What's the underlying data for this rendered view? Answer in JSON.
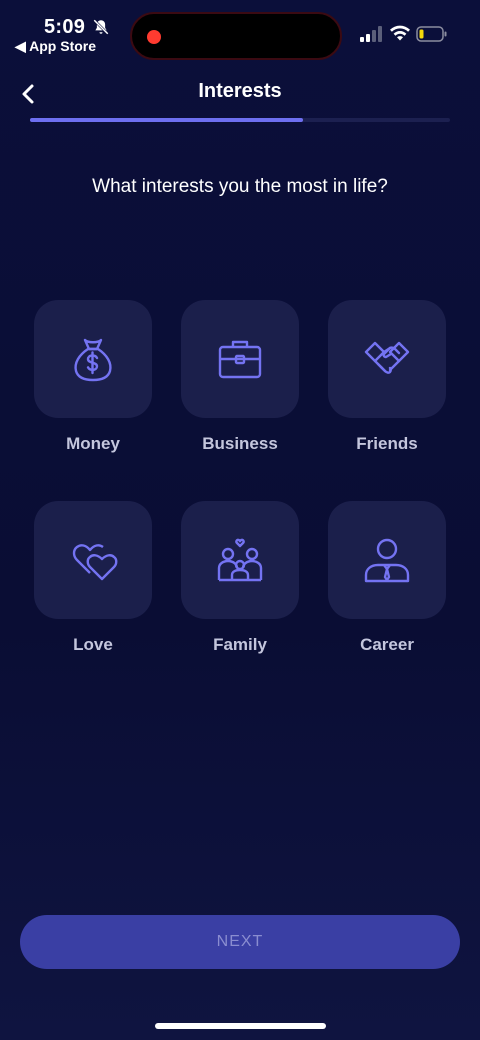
{
  "status_bar": {
    "time": "5:09",
    "back_app": "◀ App Store",
    "icons": [
      "bell-slash-icon",
      "signal-icon",
      "wifi-icon",
      "battery-low-icon"
    ],
    "recording_color": "#ff3b30"
  },
  "header": {
    "back_icon": "chevron-left-icon",
    "title": "Interests"
  },
  "progress": {
    "fraction": 0.65,
    "fill_color": "#6e6ff0"
  },
  "question": "What interests you the most in life?",
  "interests": [
    {
      "label": "Money",
      "icon": "money-bag-icon"
    },
    {
      "label": "Business",
      "icon": "briefcase-icon"
    },
    {
      "label": "Friends",
      "icon": "handshake-icon"
    },
    {
      "label": "Love",
      "icon": "hearts-icon"
    },
    {
      "label": "Family",
      "icon": "family-icon"
    },
    {
      "label": "Career",
      "icon": "person-tie-icon"
    }
  ],
  "next_button": {
    "label": "NEXT"
  },
  "colors": {
    "background": "#0b0f3a",
    "tile": "#1b1f4b",
    "accent": "#7473f2",
    "button": "#3a3fa4"
  }
}
